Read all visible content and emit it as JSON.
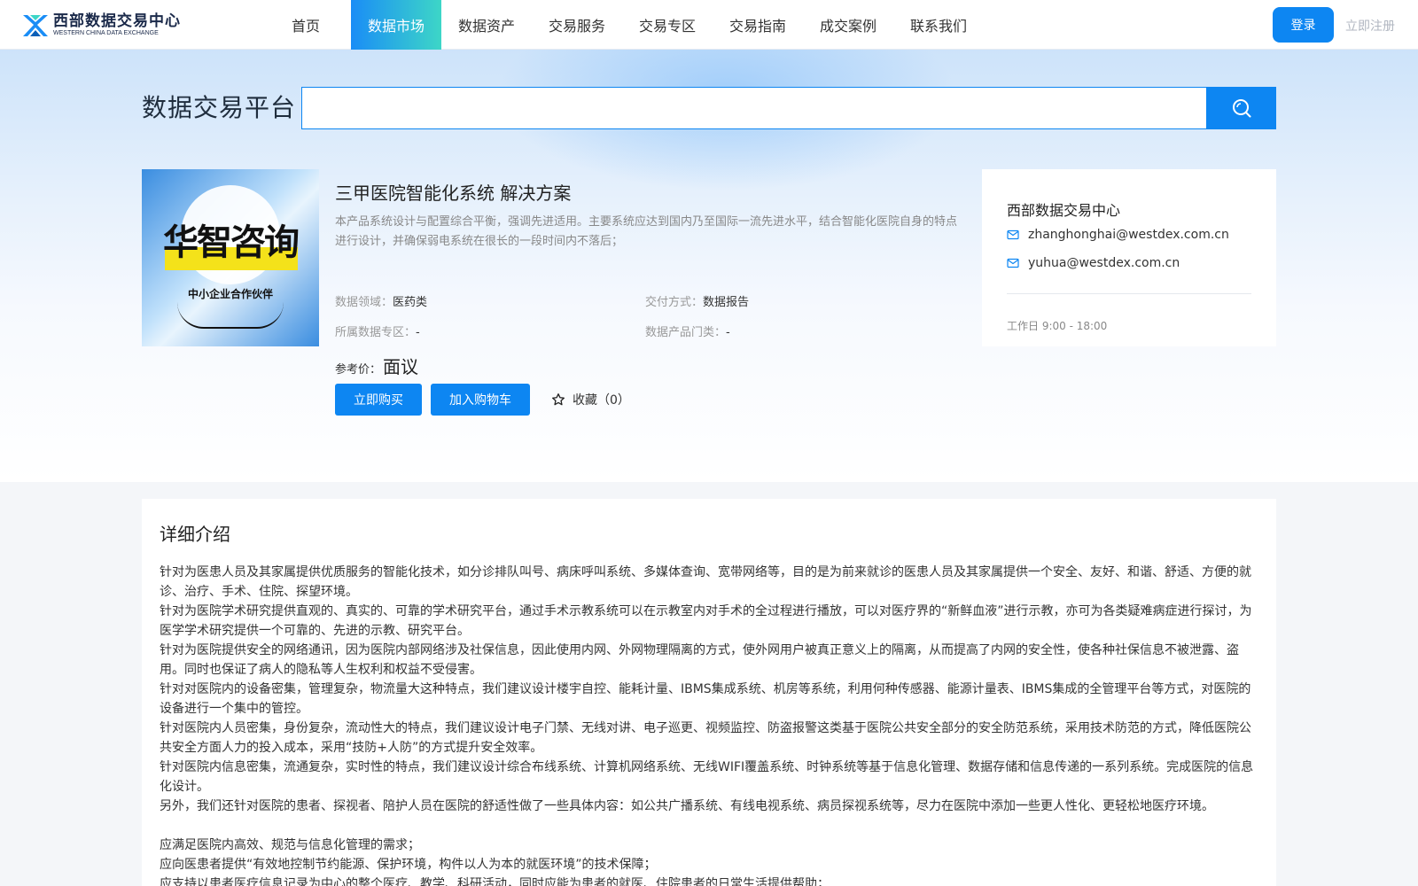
{
  "header": {
    "logo_cn": "西部数据交易中心",
    "logo_en": "WESTERN CHINA DATA EXCHANGE",
    "nav": [
      "首页",
      "数据市场",
      "数据资产",
      "交易服务",
      "交易专区",
      "交易指南",
      "成交案例",
      "联系我们"
    ],
    "active_nav": "数据市场",
    "login_label": "登录",
    "register_label": "立即注册"
  },
  "search": {
    "platform_title": "数据交易平台",
    "placeholder": "",
    "button_icon": "search-icon"
  },
  "product": {
    "image_brand": "华智咨询",
    "image_sub": "中小企业合作伙伴",
    "title": "三甲医院智能化系统 解决方案",
    "description": "本产品系统设计与配置综合平衡，强调先进适用。主要系统应达到国内乃至国际一流先进水平，结合智能化医院自身的特点进行设计，并确保弱电系统在很长的一段时间内不落后；",
    "fields": {
      "domain_label": "数据领域：",
      "domain_value": "医药类",
      "delivery_label": "交付方式：",
      "delivery_value": "数据报告",
      "zone_label": "所属数据专区：",
      "zone_value": "-",
      "category_label": "数据产品门类：",
      "category_value": "-"
    },
    "price_label": "参考价：",
    "price_value": "面议",
    "buy_label": "立即购买",
    "cart_label": "加入购物车",
    "favorite_label": "收藏（0）"
  },
  "contact": {
    "title": "西部数据交易中心",
    "emails": [
      "zhanghonghai@westdex.com.cn",
      "yuhua@westdex.com.cn"
    ],
    "hours": "工作日 9:00 - 18:00"
  },
  "detail": {
    "title": "详细介绍",
    "paragraphs": [
      "针对为医患人员及其家属提供优质服务的智能化技术，如分诊排队叫号、病床呼叫系统、多媒体查询、宽带网络等，目的是为前来就诊的医患人员及其家属提供一个安全、友好、和谐、舒适、方便的就诊、治疗、手术、住院、探望环境。",
      "针对为医院学术研究提供直观的、真实的、可靠的学术研究平台，通过手术示教系统可以在示教室内对手术的全过程进行播放，可以对医疗界的“新鲜血液”进行示教，亦可为各类疑难病症进行探讨，为医学学术研究提供一个可靠的、先进的示教、研究平台。",
      "针对为医院提供安全的网络通讯，因为医院内部网络涉及社保信息，因此使用内网、外网物理隔离的方式，使外网用户被真正意义上的隔离，从而提高了内网的安全性，使各种社保信息不被泄露、盗用。同时也保证了病人的隐私等人生权利和权益不受侵害。",
      "针对对医院内的设备密集，管理复杂，物流量大这种特点，我们建议设计楼宇自控、能耗计量、IBMS集成系统、机房等系统，利用何种传感器、能源计量表、IBMS集成的全管理平台等方式，对医院的设备进行一个集中的管控。",
      "针对医院内人员密集，身份复杂，流动性大的特点，我们建议设计电子门禁、无线对讲、电子巡更、视频监控、防盗报警这类基于医院公共安全部分的安全防范系统，采用技术防范的方式，降低医院公共安全方面人力的投入成本，采用“技防+人防”的方式提升安全效率。",
      "针对医院内信息密集，流通复杂，实时性的特点，我们建议设计综合布线系统、计算机网络系统、无线WIFI覆盖系统、时钟系统等基于信息化管理、数据存储和信息传递的一系列系统。完成医院的信息化设计。",
      "另外，我们还针对医院的患者、探视者、陪护人员在医院的舒适性做了一些具体内容：如公共广播系统、有线电视系统、病员探视系统等，尽力在医院中添加一些更人性化、更轻松地医疗环境。"
    ],
    "bullets": [
      "应满足医院内高效、规范与信息化管理的需求；",
      "应向医患者提供“有效地控制节约能源、保护环境，构件以人为本的就医环境”的技术保障；",
      "应支持以患者医疗信息记录为中心的整个医疗、教学、科研活动，同时应能为患者的就医、住院患者的日常生活提供帮助；"
    ]
  }
}
